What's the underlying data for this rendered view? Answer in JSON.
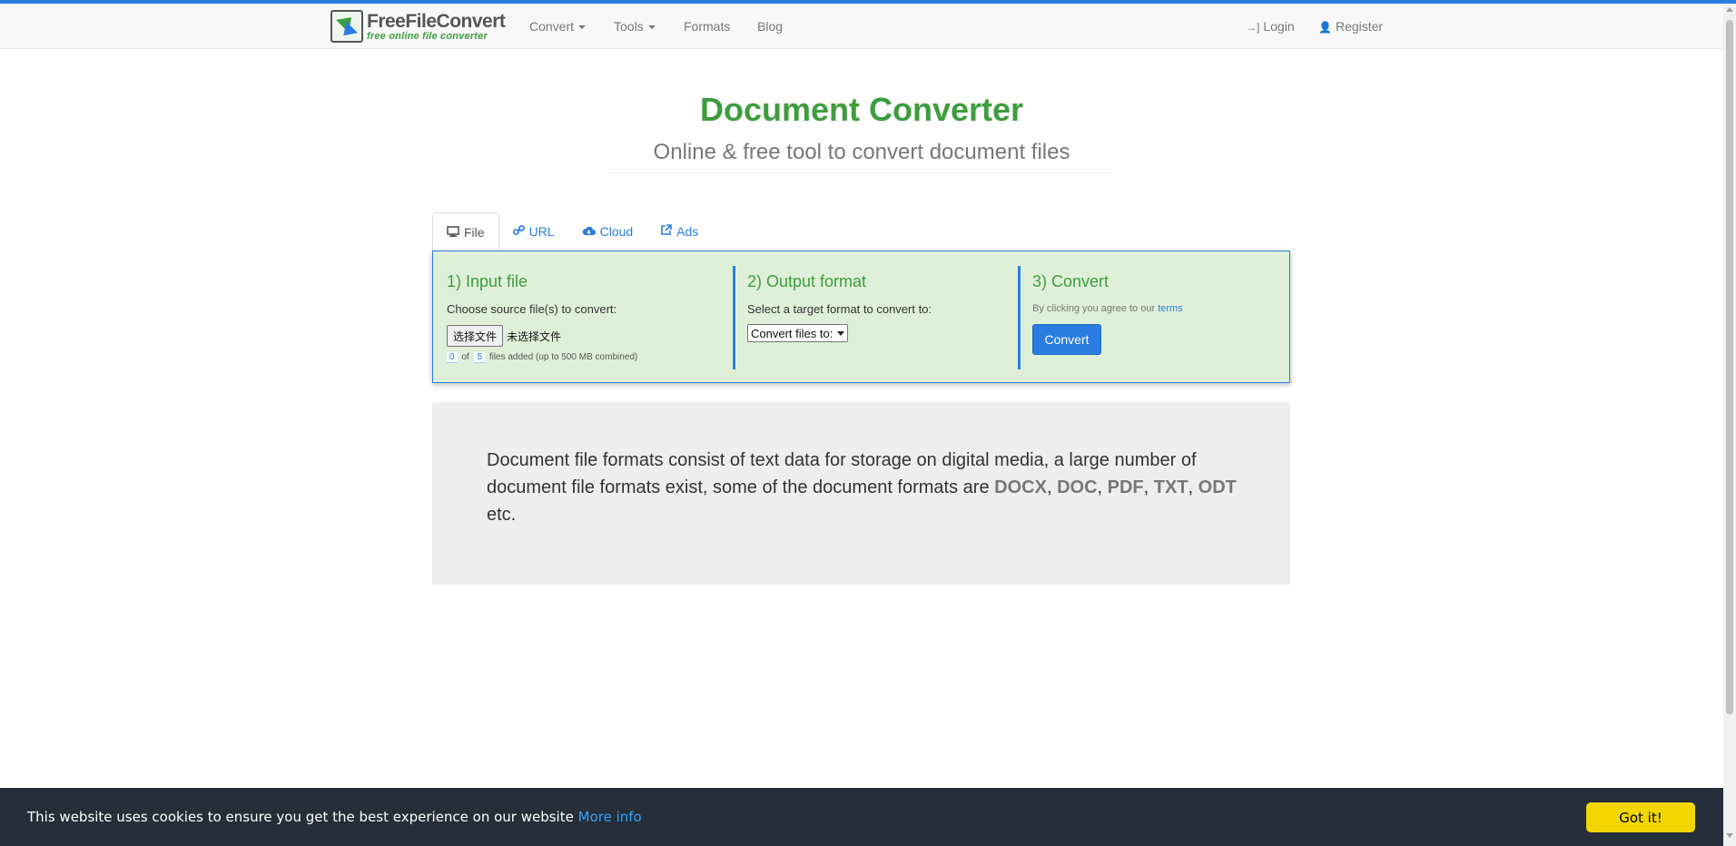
{
  "navbar": {
    "logo": {
      "title": "FreeFileConvert",
      "subtitle": "free online file converter"
    },
    "items": [
      {
        "label": "Convert",
        "has_caret": true
      },
      {
        "label": "Tools",
        "has_caret": true
      },
      {
        "label": "Formats",
        "has_caret": false
      },
      {
        "label": "Blog",
        "has_caret": false
      }
    ],
    "login_label": "Login",
    "register_label": "Register",
    "login_icon": "sign-in-icon",
    "register_icon": "user-icon"
  },
  "header": {
    "title": "Document Converter",
    "subtitle": "Online & free tool to convert document files"
  },
  "tabs": [
    {
      "label": "File",
      "icon": "desktop-icon",
      "active": true
    },
    {
      "label": "URL",
      "icon": "link-icon",
      "active": false
    },
    {
      "label": "Cloud",
      "icon": "cloud-download-icon",
      "active": false
    },
    {
      "label": "Ads",
      "icon": "external-link-icon",
      "active": false
    }
  ],
  "converter": {
    "input": {
      "title": "1) Input file",
      "label": "Choose source file(s) to convert:",
      "file_button": "选择文件",
      "file_status": "未选择文件",
      "count": "0",
      "of": "of",
      "max": "5",
      "note": "files added (up to 500 MB combined)"
    },
    "output": {
      "title": "2) Output format",
      "label": "Select a target format to convert to:",
      "select_value": "Convert files to:"
    },
    "convert": {
      "title": "3) Convert",
      "agree_text": "By clicking you agree to our",
      "terms_link": "terms",
      "button_label": "Convert"
    }
  },
  "info": {
    "text_before": "Document file formats consist of text data for storage on digital media, a large number of document file formats exist, some of the document formats are",
    "formats": [
      "DOCX",
      "DOC",
      "PDF",
      "TXT",
      "ODT"
    ],
    "text_after": "etc."
  },
  "cookie_bar": {
    "text": "This website uses cookies to ensure you get the best experience on our website",
    "more_info": "More info",
    "button_label": "Got it!"
  },
  "colors": {
    "accent": "#2a7ce0",
    "green": "#3e9d3e",
    "panel_bg": "#dff0d8",
    "cookie_bg": "#252e39",
    "cookie_button": "#f1d600"
  }
}
